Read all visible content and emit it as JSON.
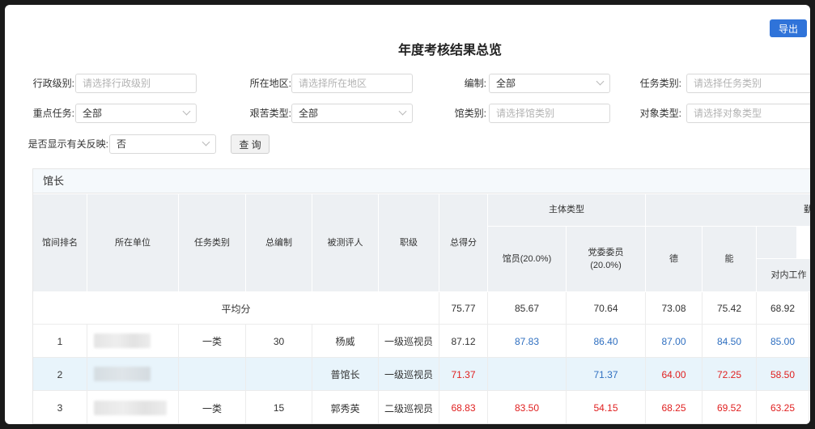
{
  "toolbar": {
    "export_label": "导出"
  },
  "page": {
    "title": "年度考核结果总览"
  },
  "filters": {
    "admin_level": {
      "label": "行政级别:",
      "placeholder": "请选择行政级别"
    },
    "region": {
      "label": "所在地区:",
      "placeholder": "请选择所在地区"
    },
    "staffing": {
      "label": "编制:",
      "value": "全部"
    },
    "task_type": {
      "label": "任务类别:",
      "placeholder": "请选择任务类别"
    },
    "key_task": {
      "label": "重点任务:",
      "value": "全部"
    },
    "hardship": {
      "label": "艰苦类型:",
      "value": "全部"
    },
    "hall_type": {
      "label": "馆类别:",
      "placeholder": "请选择馆类别"
    },
    "target_type": {
      "label": "对象类型:",
      "placeholder": "请选择对象类型"
    },
    "show_feedback": {
      "label": "是否显示有关反映:",
      "value": "否"
    },
    "query_label": "查 询"
  },
  "table": {
    "section_title": "馆长",
    "headers": {
      "rank": "馆间排名",
      "unit": "所在单位",
      "task": "任务类别",
      "total_staff": "总编制",
      "person": "被测评人",
      "rank_level": "职级",
      "total_score": "总得分",
      "subject_type": "主体类型",
      "staff_pct": "馆员(20.0%)",
      "party_pct_l1": "党委委员",
      "party_pct_l2": "(20.0%)",
      "de": "德",
      "neng": "能",
      "clipped_group": "勤",
      "internal_work": "对内工作"
    },
    "average_row": {
      "label": "平均分",
      "total": "75.77",
      "staff": "85.67",
      "party": "70.64",
      "de": "73.08",
      "neng": "75.42",
      "internal": "68.92"
    },
    "rows": [
      {
        "rank": "1",
        "task": "一类",
        "total_staff": "30",
        "person": "杨威",
        "level": "一级巡视员",
        "total": "87.12",
        "staff": "87.83",
        "party": "86.40",
        "de": "87.00",
        "neng": "84.50",
        "internal": "85.00"
      },
      {
        "rank": "2",
        "task": "",
        "total_staff": "",
        "person": "普馆长",
        "level": "一级巡视员",
        "total": "71.37",
        "staff": "",
        "party": "71.37",
        "de": "64.00",
        "neng": "72.25",
        "internal": "58.50"
      },
      {
        "rank": "3",
        "task": "一类",
        "total_staff": "15",
        "person": "郭秀英",
        "level": "二级巡视员",
        "total": "68.83",
        "staff": "83.50",
        "party": "54.15",
        "de": "68.25",
        "neng": "69.52",
        "internal": "63.25"
      }
    ]
  },
  "colors": {
    "accent": "#2f73d9",
    "blue_value": "#2f6fc0",
    "red_value": "#e02020",
    "highlight_row": "#e8f4fb",
    "header_bg": "#edf0f3"
  }
}
